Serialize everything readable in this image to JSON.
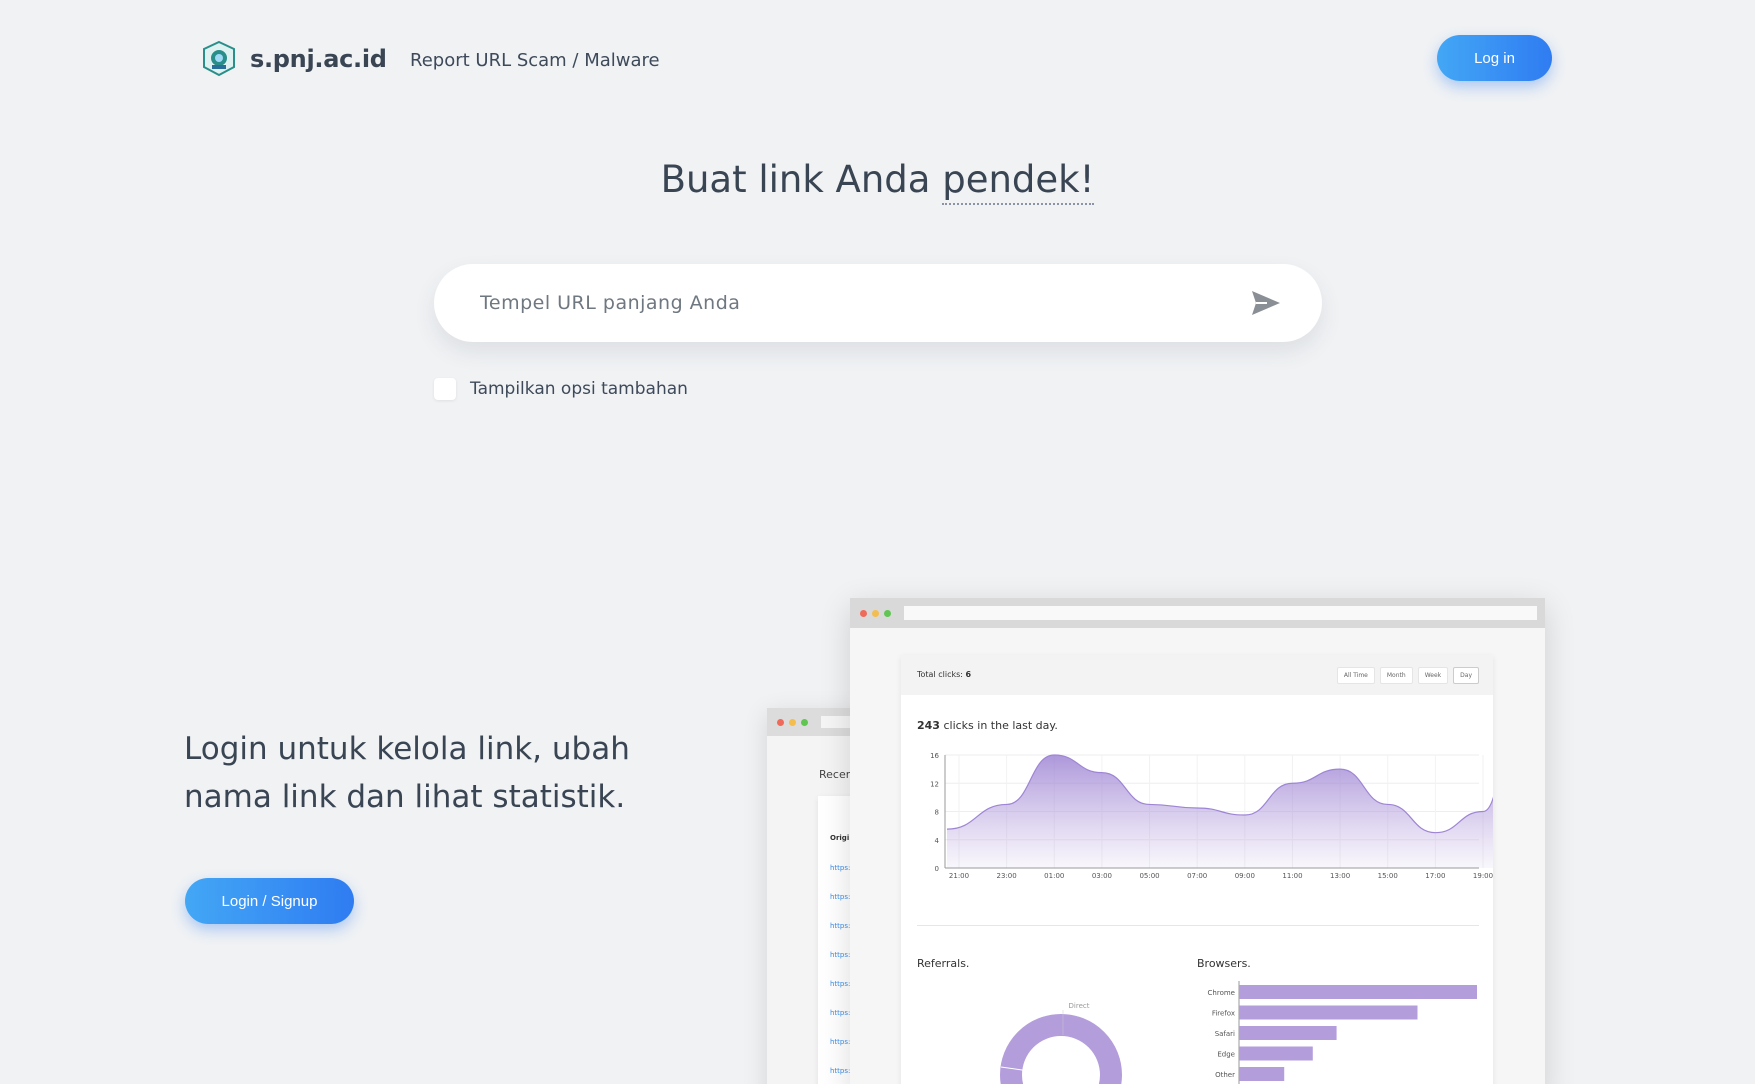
{
  "header": {
    "logo_text": "s.pnj.ac.id",
    "nav_link": "Report URL Scam / Malware",
    "login_label": "Log in"
  },
  "hero": {
    "title_prefix": "Buat link Anda ",
    "title_highlight": "pendek!",
    "input_placeholder": "Tempel URL panjang Anda",
    "options_label": "Tampilkan opsi tambahan"
  },
  "promo": {
    "text": "Login untuk kelola link, ubah nama link dan lihat statistik.",
    "button_label": "Login / Signup"
  },
  "mockup": {
    "back_label": "Recen",
    "back_column": "Origi",
    "back_links": [
      "https:",
      "https:",
      "https:",
      "https:",
      "https:",
      "https:",
      "https:",
      "https:"
    ],
    "total_clicks_label": "Total clicks: ",
    "total_clicks_value": "6",
    "range_buttons": [
      "All Time",
      "Month",
      "Week",
      "Day"
    ],
    "clicks_count": "243",
    "clicks_text": " clicks in the last day.",
    "referrals_label": "Referrals.",
    "browsers_label": "Browsers.",
    "donut_label": "Direct",
    "colors": {
      "purple": "#b39ddb",
      "purple_dark": "#9e85d4",
      "dot_red": "#ee6a5b",
      "dot_yellow": "#f3bd4f",
      "dot_green": "#61c554"
    }
  },
  "chart_data": [
    {
      "type": "area",
      "x": [
        "21:00",
        "23:00",
        "01:00",
        "03:00",
        "05:00",
        "07:00",
        "09:00",
        "11:00",
        "13:00",
        "15:00",
        "17:00",
        "19:00"
      ],
      "values": [
        5.5,
        9,
        16,
        13.5,
        9,
        8.5,
        7.5,
        12,
        14,
        9,
        5,
        8,
        16
      ],
      "points_x": [
        0,
        1,
        2,
        3,
        4,
        5,
        6,
        7,
        8,
        9,
        10,
        11,
        11.6
      ],
      "yticks": [
        0,
        4,
        8,
        12,
        16
      ],
      "ylim": [
        0,
        16
      ]
    },
    {
      "type": "pie",
      "labels": [
        "Direct"
      ],
      "values": [
        100
      ]
    },
    {
      "type": "bar",
      "categories": [
        "Chrome",
        "Firefox",
        "Safari",
        "Edge",
        "Other"
      ],
      "values": [
        100,
        75,
        41,
        31,
        19
      ]
    }
  ]
}
